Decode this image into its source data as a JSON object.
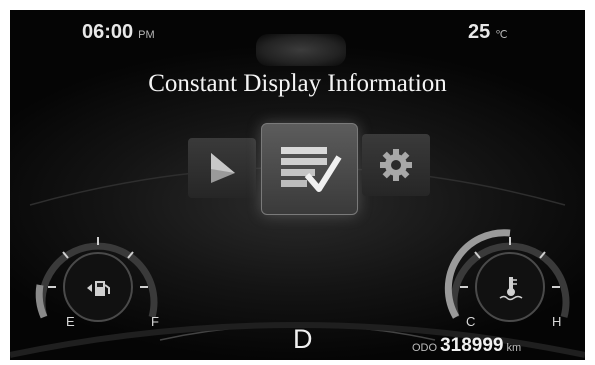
{
  "status_bar": {
    "time": "06:00",
    "time_period": "PM",
    "temperature": "25",
    "temperature_unit": "℃"
  },
  "menu": {
    "title": "Constant Display Information",
    "items": [
      {
        "label": "navigation",
        "icon": "navigation-arrow-icon",
        "selected": false
      },
      {
        "label": "display-information",
        "icon": "list-check-icon",
        "selected": true
      },
      {
        "label": "settings",
        "icon": "gear-icon",
        "selected": false
      }
    ]
  },
  "fuel_gauge": {
    "empty_label": "E",
    "full_label": "F",
    "icon": "fuel-pump-icon",
    "level": 0.1
  },
  "temp_gauge": {
    "cold_label": "C",
    "hot_label": "H",
    "icon": "coolant-temperature-icon",
    "level": 0.4
  },
  "drive": {
    "gear": "D",
    "odo_label": "ODO",
    "odo_value": "318999",
    "odo_unit": "km"
  },
  "colors": {
    "background": "#0a0a0a",
    "text": "#f0f0f0",
    "selected_tile": "#5c5c5c"
  }
}
